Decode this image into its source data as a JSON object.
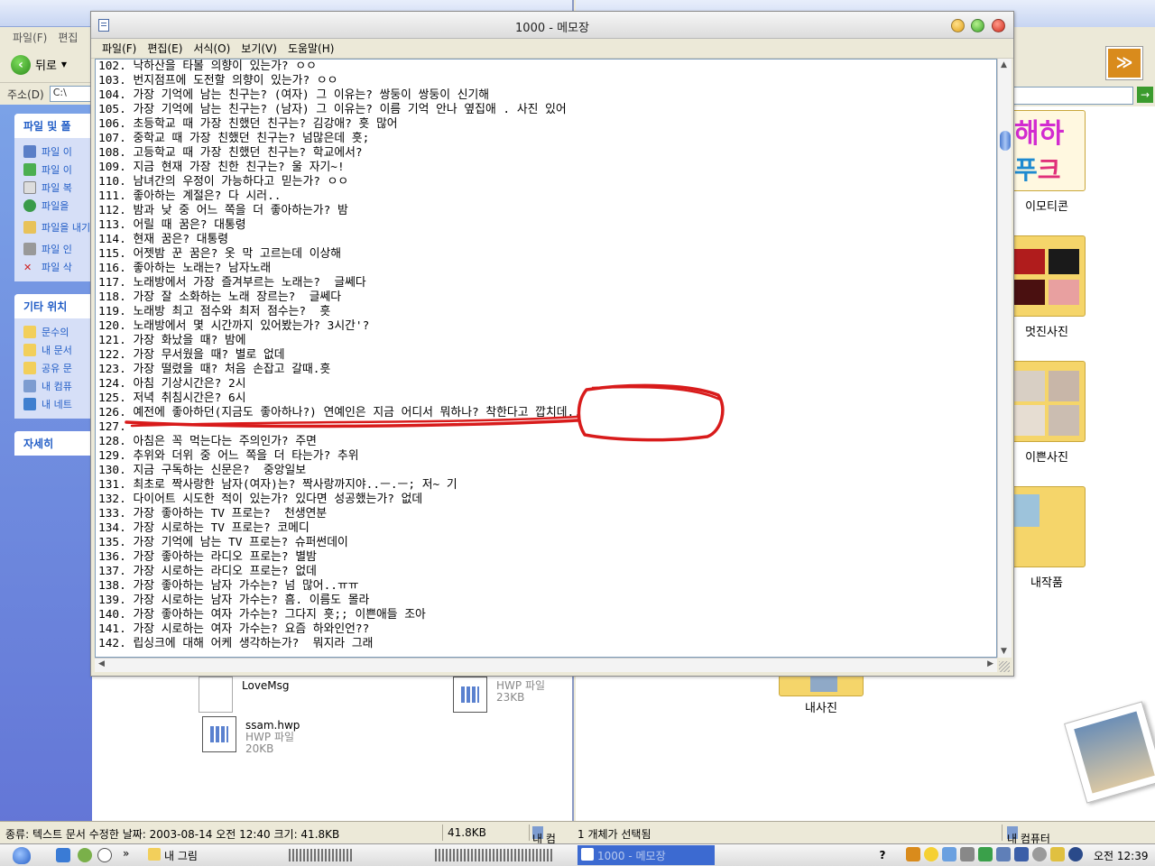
{
  "left_explorer": {
    "menu": [
      "파일(F)",
      "편집"
    ],
    "back_label": "뒤로",
    "address_label": "주소(D)",
    "address_value": "C:\\",
    "task_panels": [
      {
        "title": "파일 및 폴",
        "items": [
          "파일 이",
          "파일 이",
          "파일 복",
          "파일을",
          "파일을 내기",
          "파일 인",
          "파일 삭"
        ]
      },
      {
        "title": "기타 위치",
        "items": [
          "문수의",
          "내 문서",
          "공유 문",
          "내 컴퓨",
          "내 네트"
        ]
      },
      {
        "title": "자세히",
        "items": []
      }
    ],
    "files": [
      {
        "name": "LoveMsg",
        "type": "",
        "size": ""
      },
      {
        "name": "ssam.hwp",
        "type": "HWP 파일",
        "size": "20KB"
      },
      {
        "name": "",
        "type": "HWP 파일",
        "size": "23KB"
      }
    ]
  },
  "right_explorer": {
    "folders": [
      "이모티콘",
      "멋진사진",
      "이쁜사진",
      "내작품",
      "내사진"
    ]
  },
  "notepad": {
    "title": "1000 - 메모장",
    "menu": [
      "파일(F)",
      "편집(E)",
      "서식(O)",
      "보기(V)",
      "도움말(H)"
    ],
    "lines": [
      "102. 낙하산을 타볼 의향이 있는가? ㅇㅇ",
      "103. 번지점프에 도전할 의향이 있는가? ㅇㅇ",
      "104. 가장 기억에 남는 친구는? (여자) 그 이유는? 쌍둥이 쌍둥이 신기해",
      "105. 가장 기억에 남는 친구는? (남자) 그 이유는? 이름 기억 안나 옆집애 . 사진 있어",
      "106. 초등학교 때 가장 친했던 친구는? 김강애? 흣 많어",
      "107. 중학교 때 가장 친했던 친구는? 넘많은데 흣;",
      "108. 고등학교 때 가장 친했던 친구는? 학교에서?",
      "109. 지금 현재 가장 친한 친구는? 울 자기~!",
      "110. 남녀간의 우정이 가능하다고 믿는가? ㅇㅇ",
      "111. 좋아하는 계절은? 다 시러..",
      "112. 밤과 낮 중 어느 쪽을 더 좋아하는가? 밤",
      "113. 어릴 때 꿈은? 대통령",
      "114. 현재 꿈은? 대통령",
      "115. 어젯밤 꾼 꿈은? 옷 막 고르는데 이상해",
      "116. 좋아하는 노래는? 남자노래",
      "117. 노래방에서 가장 즐겨부르는 노래는?  글쎄다",
      "118. 가장 잘 소화하는 노래 장르는?  글쎄다",
      "119. 노래방 최고 점수와 최저 점수는?  흣",
      "120. 노래방에서 몇 시간까지 있어봤는가? 3시간'?",
      "121. 가장 화났을 때? 밤에",
      "122. 가장 무서웠을 때? 별로 없데",
      "123. 가장 떨렸을 때? 처음 손잡고 갈때.흣",
      "124. 아침 기상시간은? 2시",
      "125. 저녁 취침시간은? 6시",
      "126. 예전에 좋아하던(지금도 좋아하나?) 연예인은 지금 어디서 뭐하나? 착한다고 깝치데..",
      "127. ",
      "128. 아침은 꼭 먹는다는 주의인가? 주면",
      "129. 추위와 더위 중 어느 쪽을 더 타는가? 추위",
      "130. 지금 구독하는 신문은?  중앙일보",
      "131. 최초로 짝사랑한 남자(여자)는? 짝사랑까지야..ㅡ.ㅡ; 저~ 기",
      "132. 다이어트 시도한 적이 있는가? 있다면 성공했는가? 없데",
      "133. 가장 좋아하는 TV 프로는?  천생연분",
      "134. 가장 시로하는 TV 프로는? 코메디",
      "135. 가장 기억에 남는 TV 프로는? 슈퍼썬데이",
      "136. 가장 좋아하는 라디오 프로는? 별밤",
      "137. 가장 시로하는 라디오 프로는? 없데",
      "138. 가장 좋아하는 남자 가수는? 넘 많어..ㅠㅠ",
      "139. 가장 시로하는 남자 가수는? 흠. 이름도 몰라",
      "140. 가장 좋아하는 여자 가수는? 그다지 흣;; 이쁜애들 조아",
      "141. 가장 시로하는 여자 가수는? 요즘 하와인언??",
      "142. 립싱크에 대해 어케 생각하는가?  뭐지라 그래"
    ]
  },
  "statusbar": {
    "info": "종류: 텍스트 문서 수정한 날짜: 2003-08-14 오전 12:40 크기: 41.8KB",
    "size": "41.8KB",
    "computer_left": "내 컴",
    "selection": "1 개체가 선택됨",
    "computer_right": "내 컴퓨터"
  },
  "taskbar": {
    "tasks": [
      "내 그림",
      "1000 - 메모장"
    ],
    "clock": "오전 12:39",
    "help": "?",
    "chevron": "»"
  },
  "colors": {
    "scribble_red": "#d81b1b",
    "task_active": "#3c6ad1",
    "link_blue": "#215dc6"
  }
}
